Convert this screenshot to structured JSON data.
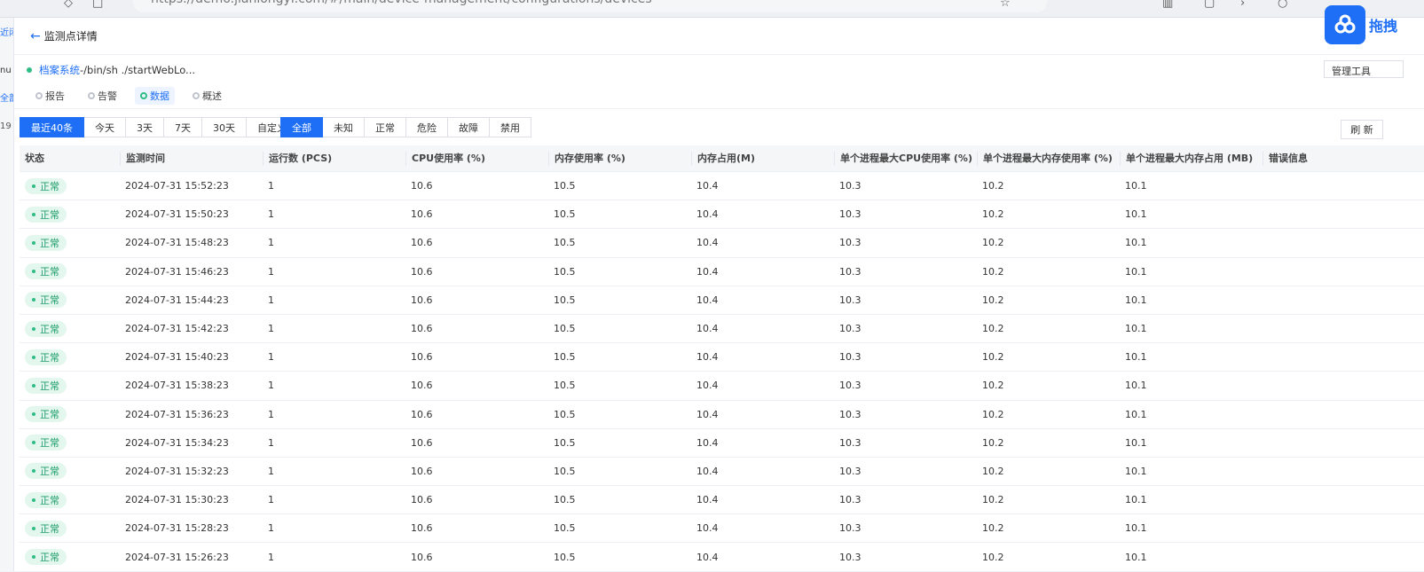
{
  "browser": {
    "url": "https://demo.jianlongyi.com/#/main/device-management/configurations/devices"
  },
  "left_strip": [
    "近闭",
    "nu",
    "全部",
    "19"
  ],
  "header": {
    "back_label": "监测点详情"
  },
  "system": {
    "name": "档案系统",
    "cmd": "-/bin/sh ./startWebLo..."
  },
  "tool_select": "管理工具",
  "subtabs": [
    "报告",
    "告警",
    "数据",
    "概述"
  ],
  "time_filters": [
    "最近40条",
    "今天",
    "3天",
    "7天",
    "30天",
    "自定义"
  ],
  "status_filters": [
    "全部",
    "未知",
    "正常",
    "危险",
    "故障",
    "禁用"
  ],
  "refresh_label": "刷 新",
  "floating": {
    "label": "拖拽"
  },
  "table": {
    "columns": [
      "状态",
      "监测时间",
      "运行数 (PCS)",
      "CPU使用率 (%)",
      "内存使用率 (%)",
      "内存占用(M)",
      "单个进程最大CPU使用率 (%)",
      "单个进程最大内存使用率 (%)",
      "单个进程最大内存占用 (MB)",
      "错误信息"
    ],
    "rows": [
      [
        "正常",
        "2024-07-31 15:52:23",
        "1",
        "10.6",
        "10.5",
        "10.4",
        "10.3",
        "10.2",
        "10.1",
        ""
      ],
      [
        "正常",
        "2024-07-31 15:50:23",
        "1",
        "10.6",
        "10.5",
        "10.4",
        "10.3",
        "10.2",
        "10.1",
        ""
      ],
      [
        "正常",
        "2024-07-31 15:48:23",
        "1",
        "10.6",
        "10.5",
        "10.4",
        "10.3",
        "10.2",
        "10.1",
        ""
      ],
      [
        "正常",
        "2024-07-31 15:46:23",
        "1",
        "10.6",
        "10.5",
        "10.4",
        "10.3",
        "10.2",
        "10.1",
        ""
      ],
      [
        "正常",
        "2024-07-31 15:44:23",
        "1",
        "10.6",
        "10.5",
        "10.4",
        "10.3",
        "10.2",
        "10.1",
        ""
      ],
      [
        "正常",
        "2024-07-31 15:42:23",
        "1",
        "10.6",
        "10.5",
        "10.4",
        "10.3",
        "10.2",
        "10.1",
        ""
      ],
      [
        "正常",
        "2024-07-31 15:40:23",
        "1",
        "10.6",
        "10.5",
        "10.4",
        "10.3",
        "10.2",
        "10.1",
        ""
      ],
      [
        "正常",
        "2024-07-31 15:38:23",
        "1",
        "10.6",
        "10.5",
        "10.4",
        "10.3",
        "10.2",
        "10.1",
        ""
      ],
      [
        "正常",
        "2024-07-31 15:36:23",
        "1",
        "10.6",
        "10.5",
        "10.4",
        "10.3",
        "10.2",
        "10.1",
        ""
      ],
      [
        "正常",
        "2024-07-31 15:34:23",
        "1",
        "10.6",
        "10.5",
        "10.4",
        "10.3",
        "10.2",
        "10.1",
        ""
      ],
      [
        "正常",
        "2024-07-31 15:32:23",
        "1",
        "10.6",
        "10.5",
        "10.4",
        "10.3",
        "10.2",
        "10.1",
        ""
      ],
      [
        "正常",
        "2024-07-31 15:30:23",
        "1",
        "10.6",
        "10.5",
        "10.4",
        "10.3",
        "10.2",
        "10.1",
        ""
      ],
      [
        "正常",
        "2024-07-31 15:28:23",
        "1",
        "10.6",
        "10.5",
        "10.4",
        "10.3",
        "10.2",
        "10.1",
        ""
      ],
      [
        "正常",
        "2024-07-31 15:26:23",
        "1",
        "10.6",
        "10.5",
        "10.4",
        "10.3",
        "10.2",
        "10.1",
        ""
      ]
    ]
  },
  "colors": {
    "accent": "#1e6ff5",
    "ok": "#2ebd85"
  }
}
